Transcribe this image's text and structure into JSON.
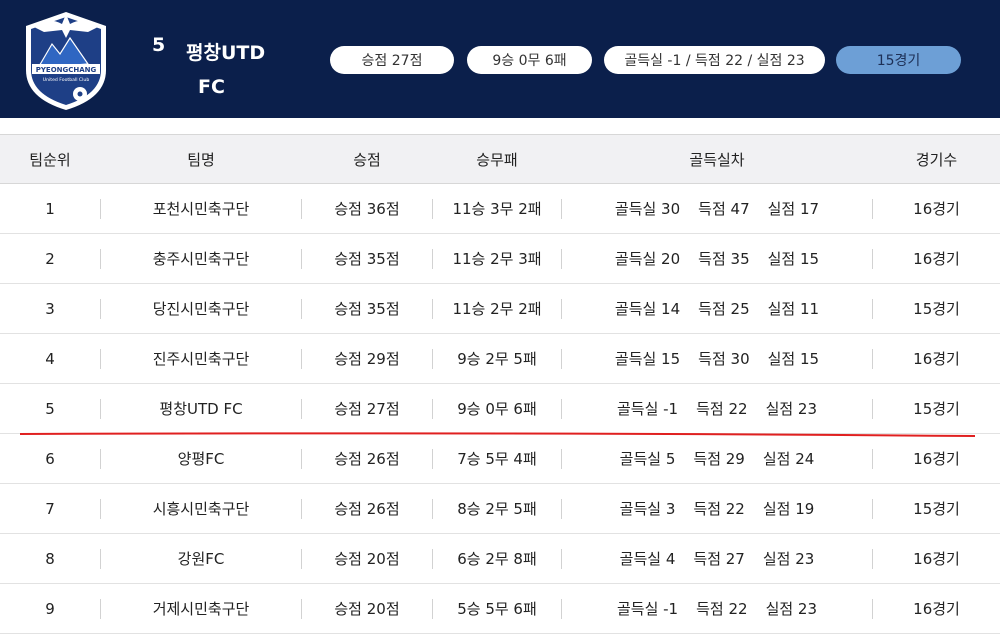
{
  "header": {
    "rank": "5",
    "team_line1": "평창UTD",
    "team_line2": "FC",
    "points": "승점 27점",
    "record": "9승 0무 6패",
    "goals": "골득실 -1 / 득점 22 / 실점 23",
    "games": "15경기",
    "logo_text": "PYEONGCHANG",
    "logo_subtext": "United Football Club"
  },
  "columns": {
    "rank": "팀순위",
    "team": "팀명",
    "points": "승점",
    "record": "승무패",
    "goal_diff": "골득실차",
    "games": "경기수"
  },
  "rows": [
    {
      "rank": "1",
      "team": "포천시민축구단",
      "points": "승점 36점",
      "record": "11승 3무 2패",
      "gd": "골득실 30",
      "gf": "득점 47",
      "ga": "실점 17",
      "games": "16경기"
    },
    {
      "rank": "2",
      "team": "충주시민축구단",
      "points": "승점 35점",
      "record": "11승 2무 3패",
      "gd": "골득실 20",
      "gf": "득점 35",
      "ga": "실점 15",
      "games": "16경기"
    },
    {
      "rank": "3",
      "team": "당진시민축구단",
      "points": "승점 35점",
      "record": "11승 2무 2패",
      "gd": "골득실 14",
      "gf": "득점 25",
      "ga": "실점 11",
      "games": "15경기"
    },
    {
      "rank": "4",
      "team": "진주시민축구단",
      "points": "승점 29점",
      "record": "9승 2무 5패",
      "gd": "골득실 15",
      "gf": "득점 30",
      "ga": "실점 15",
      "games": "16경기"
    },
    {
      "rank": "5",
      "team": "평창UTD FC",
      "points": "승점 27점",
      "record": "9승 0무 6패",
      "gd": "골득실 -1",
      "gf": "득점 22",
      "ga": "실점 23",
      "games": "15경기"
    },
    {
      "rank": "6",
      "team": "양평FC",
      "points": "승점 26점",
      "record": "7승 5무 4패",
      "gd": "골득실 5",
      "gf": "득점 29",
      "ga": "실점 24",
      "games": "16경기"
    },
    {
      "rank": "7",
      "team": "시흥시민축구단",
      "points": "승점 26점",
      "record": "8승 2무 5패",
      "gd": "골득실 3",
      "gf": "득점 22",
      "ga": "실점 19",
      "games": "15경기"
    },
    {
      "rank": "8",
      "team": "강원FC",
      "points": "승점 20점",
      "record": "6승 2무 8패",
      "gd": "골득실 4",
      "gf": "득점 27",
      "ga": "실점 23",
      "games": "16경기"
    },
    {
      "rank": "9",
      "team": "거제시민축구단",
      "points": "승점 20점",
      "record": "5승 5무 6패",
      "gd": "골득실 -1",
      "gf": "득점 22",
      "ga": "실점 23",
      "games": "16경기"
    }
  ],
  "colors": {
    "header_bg": "#0b1f4b",
    "games_pill": "#6d9fd6",
    "highlight_line": "#e02020"
  }
}
